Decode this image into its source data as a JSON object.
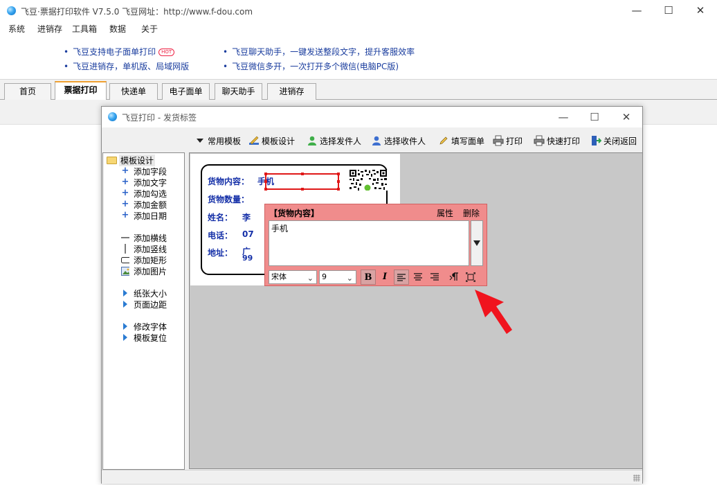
{
  "app": {
    "title": "飞豆·票据打印软件 V7.5.0  飞豆网址：http://www.f-dou.com",
    "minimize": "—",
    "maximize": "☐",
    "close": "✕"
  },
  "menu": [
    "系统",
    "进销存",
    "工具箱",
    "数据",
    "关于"
  ],
  "promos": [
    {
      "text": "飞豆支持电子面单打印",
      "badge": "HOT"
    },
    {
      "text": "飞豆进销存，单机版、局域网版"
    },
    {
      "text": "飞豆聊天助手，一键发送整段文字，提升客服效率"
    },
    {
      "text": "飞豆微信多开，一次打开多个微信(电脑PC版)"
    }
  ],
  "promo_bullet": "•",
  "tabs": [
    "首页",
    "票据打印",
    "快递单",
    "电子面单",
    "聊天助手",
    "进销存"
  ],
  "active_tab": "票据打印",
  "dialog": {
    "title": "飞豆打印 - 发货标签",
    "minimize": "—",
    "maximize": "☐",
    "close": "✕",
    "toolbar": [
      "常用模板",
      "模板设计",
      "选择发件人",
      "选择收件人",
      "填写面单",
      "打印",
      "快速打印",
      "关闭返回"
    ],
    "tree": {
      "root": "模板设计",
      "group1": [
        "添加字段",
        "添加文字",
        "添加勾选",
        "添加金额",
        "添加日期"
      ],
      "group2": [
        "添加横线",
        "添加竖线",
        "添加矩形",
        "添加图片"
      ],
      "group3": [
        "纸张大小",
        "页面边距"
      ],
      "group4": [
        "修改字体",
        "模板复位"
      ]
    },
    "label": {
      "fields": [
        {
          "label": "货物内容：",
          "value": "手机"
        },
        {
          "label": "货物数量：",
          "value": ""
        },
        {
          "label": "姓名：",
          "value": "李"
        },
        {
          "label": "电话：",
          "value": "07"
        },
        {
          "label": "地址：",
          "value": "广"
        }
      ],
      "address_line2": "99"
    },
    "property_panel": {
      "title": "【货物内容】",
      "props_link": "属性",
      "delete_link": "删除",
      "text_value": "手机",
      "font_name": "宋体",
      "font_size": "9",
      "bold": "B",
      "italic": "I"
    }
  },
  "colors": {
    "label_text": "#1530a8",
    "selection": "#e01818",
    "panel_bg": "#f08c8c",
    "canvas_bg": "#c8c8c8",
    "arrow": "#f0141e"
  }
}
